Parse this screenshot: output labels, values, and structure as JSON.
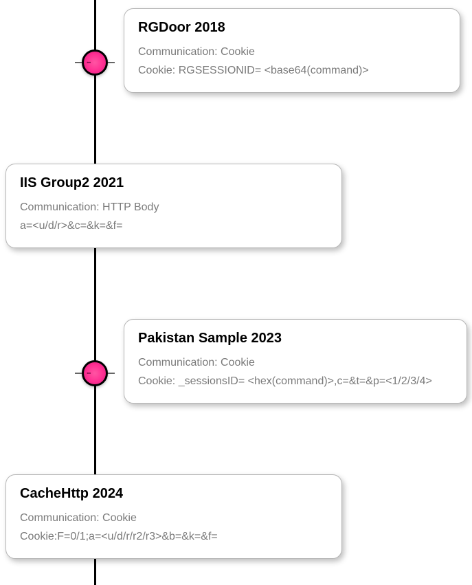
{
  "timeline": {
    "items": [
      {
        "title": "RGDoor 2018",
        "comm_label": "Communication: Cookie",
        "detail": "Cookie: RGSESSIONID= <base64(command)>",
        "side": "right",
        "has_node": true
      },
      {
        "title": "IIS Group2 2021",
        "comm_label": "Communication: HTTP Body",
        "detail": "a=<u/d/r>&c=&k=&f=",
        "side": "left",
        "has_node": false
      },
      {
        "title": "Pakistan Sample 2023",
        "comm_label": "Communication: Cookie",
        "detail": "Cookie: _sessionsID= <hex(command)>,c=&t=&p=<1/2/3/4>",
        "side": "right",
        "has_node": true
      },
      {
        "title": "CacheHttp 2024",
        "comm_label": "Communication: Cookie",
        "detail": "Cookie:F=0/1;a=<u/d/r/r2/r3>&b=&k=&f=",
        "side": "left",
        "has_node": false
      }
    ]
  }
}
